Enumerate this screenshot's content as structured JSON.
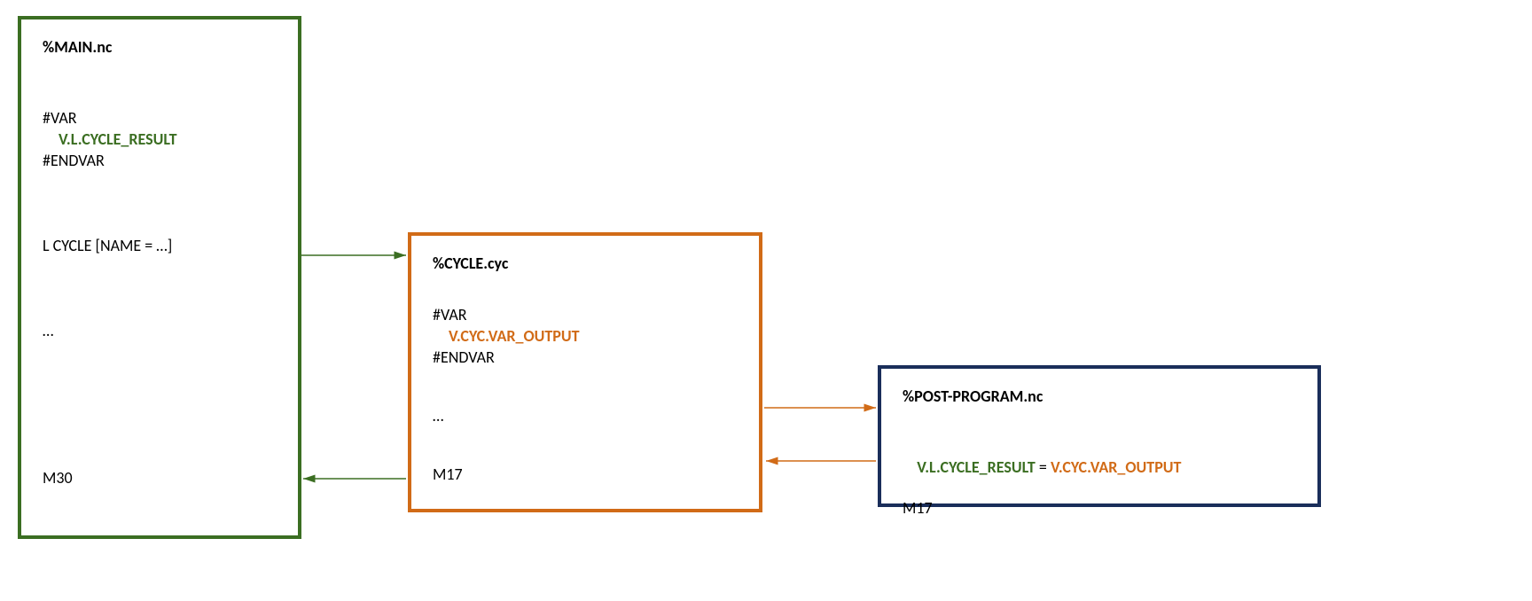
{
  "main": {
    "title": "%MAIN.nc",
    "var_open": "#VAR",
    "var_decl": "V.L.CYCLE_RESULT",
    "var_close": "#ENDVAR",
    "call": "L CYCLE [NAME = …]",
    "dots": "…",
    "end": "M30"
  },
  "cycle": {
    "title": "%CYCLE.cyc",
    "var_open": "#VAR",
    "var_decl": "V.CYC.VAR_OUTPUT",
    "var_close": "#ENDVAR",
    "dots": "…",
    "end": "M17"
  },
  "post": {
    "title": "%POST-PROGRAM.nc",
    "assign_left": "V.L.CYCLE_RESULT",
    "assign_eq": " = ",
    "assign_right": "V.CYC.VAR_OUTPUT",
    "end": "M17"
  },
  "colors": {
    "green": "#3b6e22",
    "orange": "#d16b17",
    "navy": "#1a2e5a"
  }
}
